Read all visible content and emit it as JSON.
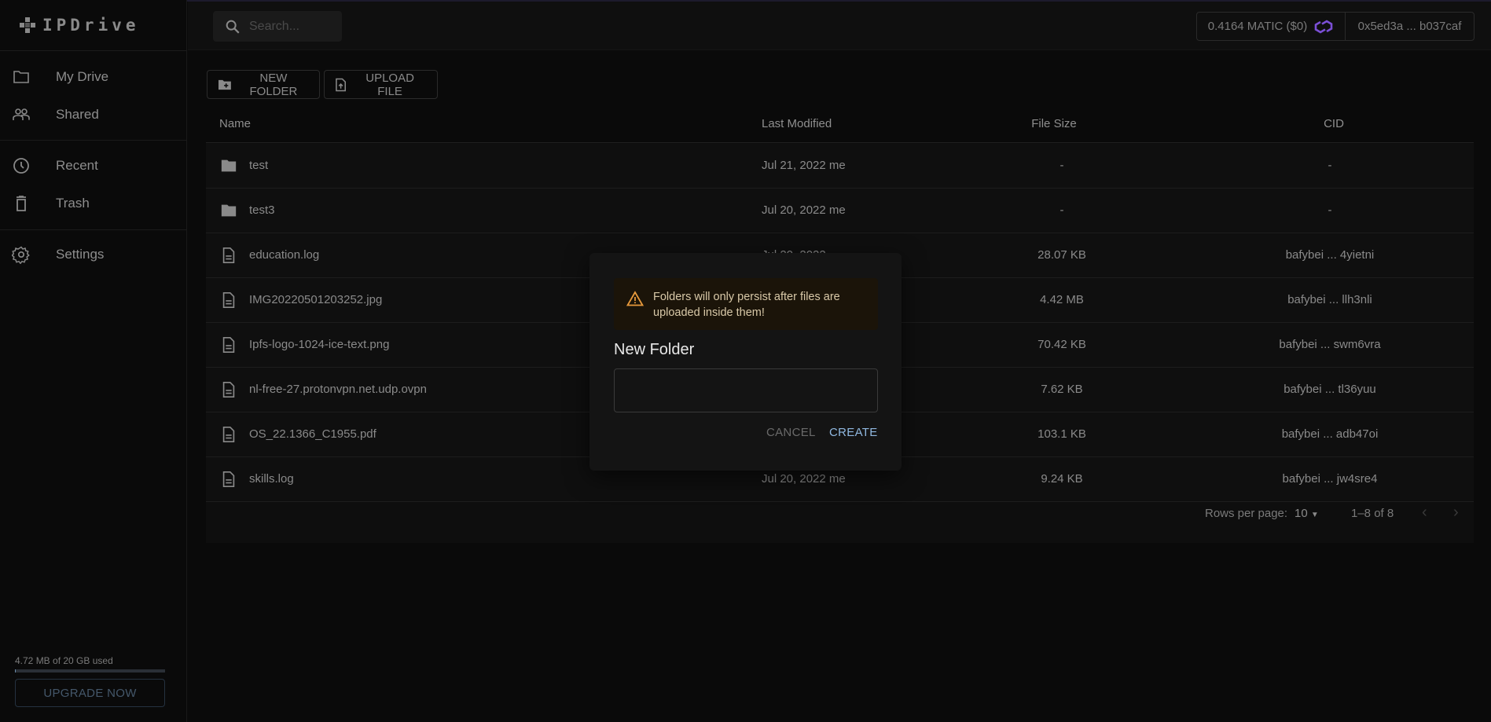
{
  "app": {
    "logo": "IPDrive"
  },
  "sidebar": {
    "items": [
      {
        "label": "My Drive",
        "icon": "folder-outline-icon"
      },
      {
        "label": "Shared",
        "icon": "people-icon"
      },
      {
        "label": "Recent",
        "icon": "clock-icon"
      },
      {
        "label": "Trash",
        "icon": "trash-icon"
      },
      {
        "label": "Settings",
        "icon": "gear-icon"
      }
    ],
    "storage": {
      "text": "4.72 MB of 20 GB used",
      "used_fraction": 0.0002
    },
    "upgrade_label": "UPGRADE NOW"
  },
  "header": {
    "search_placeholder": "Search...",
    "balance": "0.4164 MATIC ($0)",
    "address": "0x5ed3a ... b037caf",
    "polygon_color": "#7b4fd6"
  },
  "toolbar": {
    "new_folder": "NEW FOLDER",
    "upload_file": "UPLOAD FILE"
  },
  "table": {
    "columns": [
      "Name",
      "Last Modified",
      "File Size",
      "CID"
    ],
    "rows": [
      {
        "type": "folder",
        "name": "test",
        "modified": "Jul 21, 2022 me",
        "size": "-",
        "cid": "-"
      },
      {
        "type": "folder",
        "name": "test3",
        "modified": "Jul 20, 2022 me",
        "size": "-",
        "cid": "-"
      },
      {
        "type": "file",
        "name": "education.log",
        "modified": "Jul 20, 2022",
        "size": "28.07 KB",
        "cid": "bafybei ... 4yietni"
      },
      {
        "type": "file",
        "name": "IMG20220501203252.jpg",
        "modified": "",
        "size": "4.42 MB",
        "cid": "bafybei ... llh3nli"
      },
      {
        "type": "file",
        "name": "Ipfs-logo-1024-ice-text.png",
        "modified": "",
        "size": "70.42 KB",
        "cid": "bafybei ... swm6vra"
      },
      {
        "type": "file",
        "name": "nl-free-27.protonvpn.net.udp.ovpn",
        "modified": "",
        "size": "7.62 KB",
        "cid": "bafybei ... tl36yuu"
      },
      {
        "type": "file",
        "name": "OS_22.1366_C1955.pdf",
        "modified": "",
        "size": "103.1 KB",
        "cid": "bafybei ... adb47oi"
      },
      {
        "type": "file",
        "name": "skills.log",
        "modified": "Jul 20, 2022 me",
        "size": "9.24 KB",
        "cid": "bafybei ... jw4sre4"
      }
    ],
    "pagination": {
      "rows_per_page_label": "Rows per page:",
      "rows_per_page": "10",
      "range": "1–8 of 8"
    }
  },
  "dialog": {
    "warning": "Folders will only persist after files are uploaded inside them!",
    "title": "New Folder",
    "input_value": "",
    "cancel": "CANCEL",
    "create": "CREATE",
    "warning_color": "#e89a3c",
    "create_color": "#90b8e0"
  }
}
